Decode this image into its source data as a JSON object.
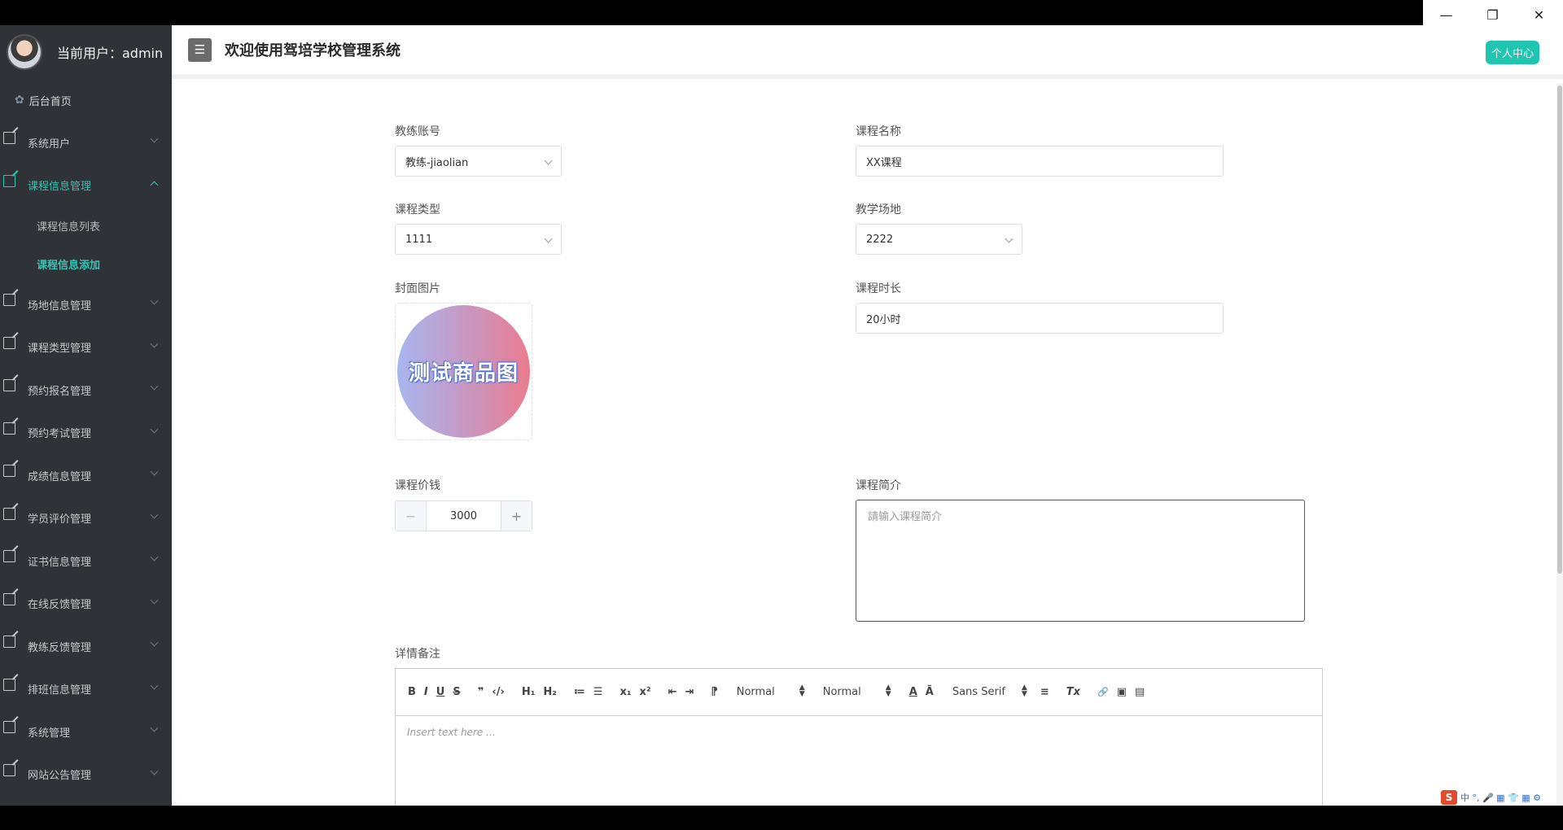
{
  "user": {
    "label": "当前用户：admin"
  },
  "home": {
    "label": "后台首页"
  },
  "menu": [
    {
      "label": "系统用户",
      "active": false
    },
    {
      "label": "课程信息管理",
      "active": true
    },
    {
      "label": "场地信息管理",
      "active": false
    },
    {
      "label": "课程类型管理",
      "active": false
    },
    {
      "label": "预约报名管理",
      "active": false
    },
    {
      "label": "预约考试管理",
      "active": false
    },
    {
      "label": "成绩信息管理",
      "active": false
    },
    {
      "label": "学员评价管理",
      "active": false
    },
    {
      "label": "证书信息管理",
      "active": false
    },
    {
      "label": "在线反馈管理",
      "active": false
    },
    {
      "label": "教练反馈管理",
      "active": false
    },
    {
      "label": "排班信息管理",
      "active": false
    },
    {
      "label": "系统管理",
      "active": false
    },
    {
      "label": "网站公告管理",
      "active": false
    }
  ],
  "submenu": [
    {
      "label": "课程信息列表"
    },
    {
      "label": "课程信息添加"
    }
  ],
  "header": {
    "menu_icon": "☰",
    "title": "欢迎使用驾培学校管理系统",
    "profile_button": "个人中心"
  },
  "form": {
    "coach_account": {
      "label": "教练账号",
      "value": "教练-jiaolian"
    },
    "course_name": {
      "label": "课程名称",
      "value": "XX课程"
    },
    "course_type": {
      "label": "课程类型",
      "value": "1111"
    },
    "venue": {
      "label": "教学场地",
      "value": "2222"
    },
    "cover": {
      "label": "封面图片",
      "image_text": "测试商品图"
    },
    "duration": {
      "label": "课程时长",
      "value": "20小时"
    },
    "price": {
      "label": "课程价钱",
      "value": "3000",
      "minus": "−",
      "plus": "+"
    },
    "intro": {
      "label": "课程简介",
      "placeholder": "請输入课程简介"
    },
    "details": {
      "label": "详情备注",
      "placeholder": "Insert text here ..."
    }
  },
  "editor_toolbar": {
    "bold": "B",
    "italic": "I",
    "underline": "U",
    "strike": "S",
    "quote": "❞",
    "code": "‹/›",
    "h1": "H₁",
    "h2": "H₂",
    "ordered_list": "≔",
    "bullet_list": "☰",
    "subscript": "x₁",
    "superscript": "x²",
    "outdent": "⇤",
    "indent": "⇥",
    "direction": "⁋",
    "size": "Normal",
    "header_select": "Normal",
    "color": "A",
    "background": "Ā",
    "font": "Sans Serif",
    "align": "≡",
    "clean": "Tx",
    "link": "🔗",
    "image": "▣",
    "video": "▤"
  },
  "window": {
    "minimize": "—",
    "restore": "❐",
    "close": "✕"
  },
  "tray": {
    "ime": "S",
    "items": "中 °, 🎤 ▦ 👕 ▦ ⚙"
  }
}
